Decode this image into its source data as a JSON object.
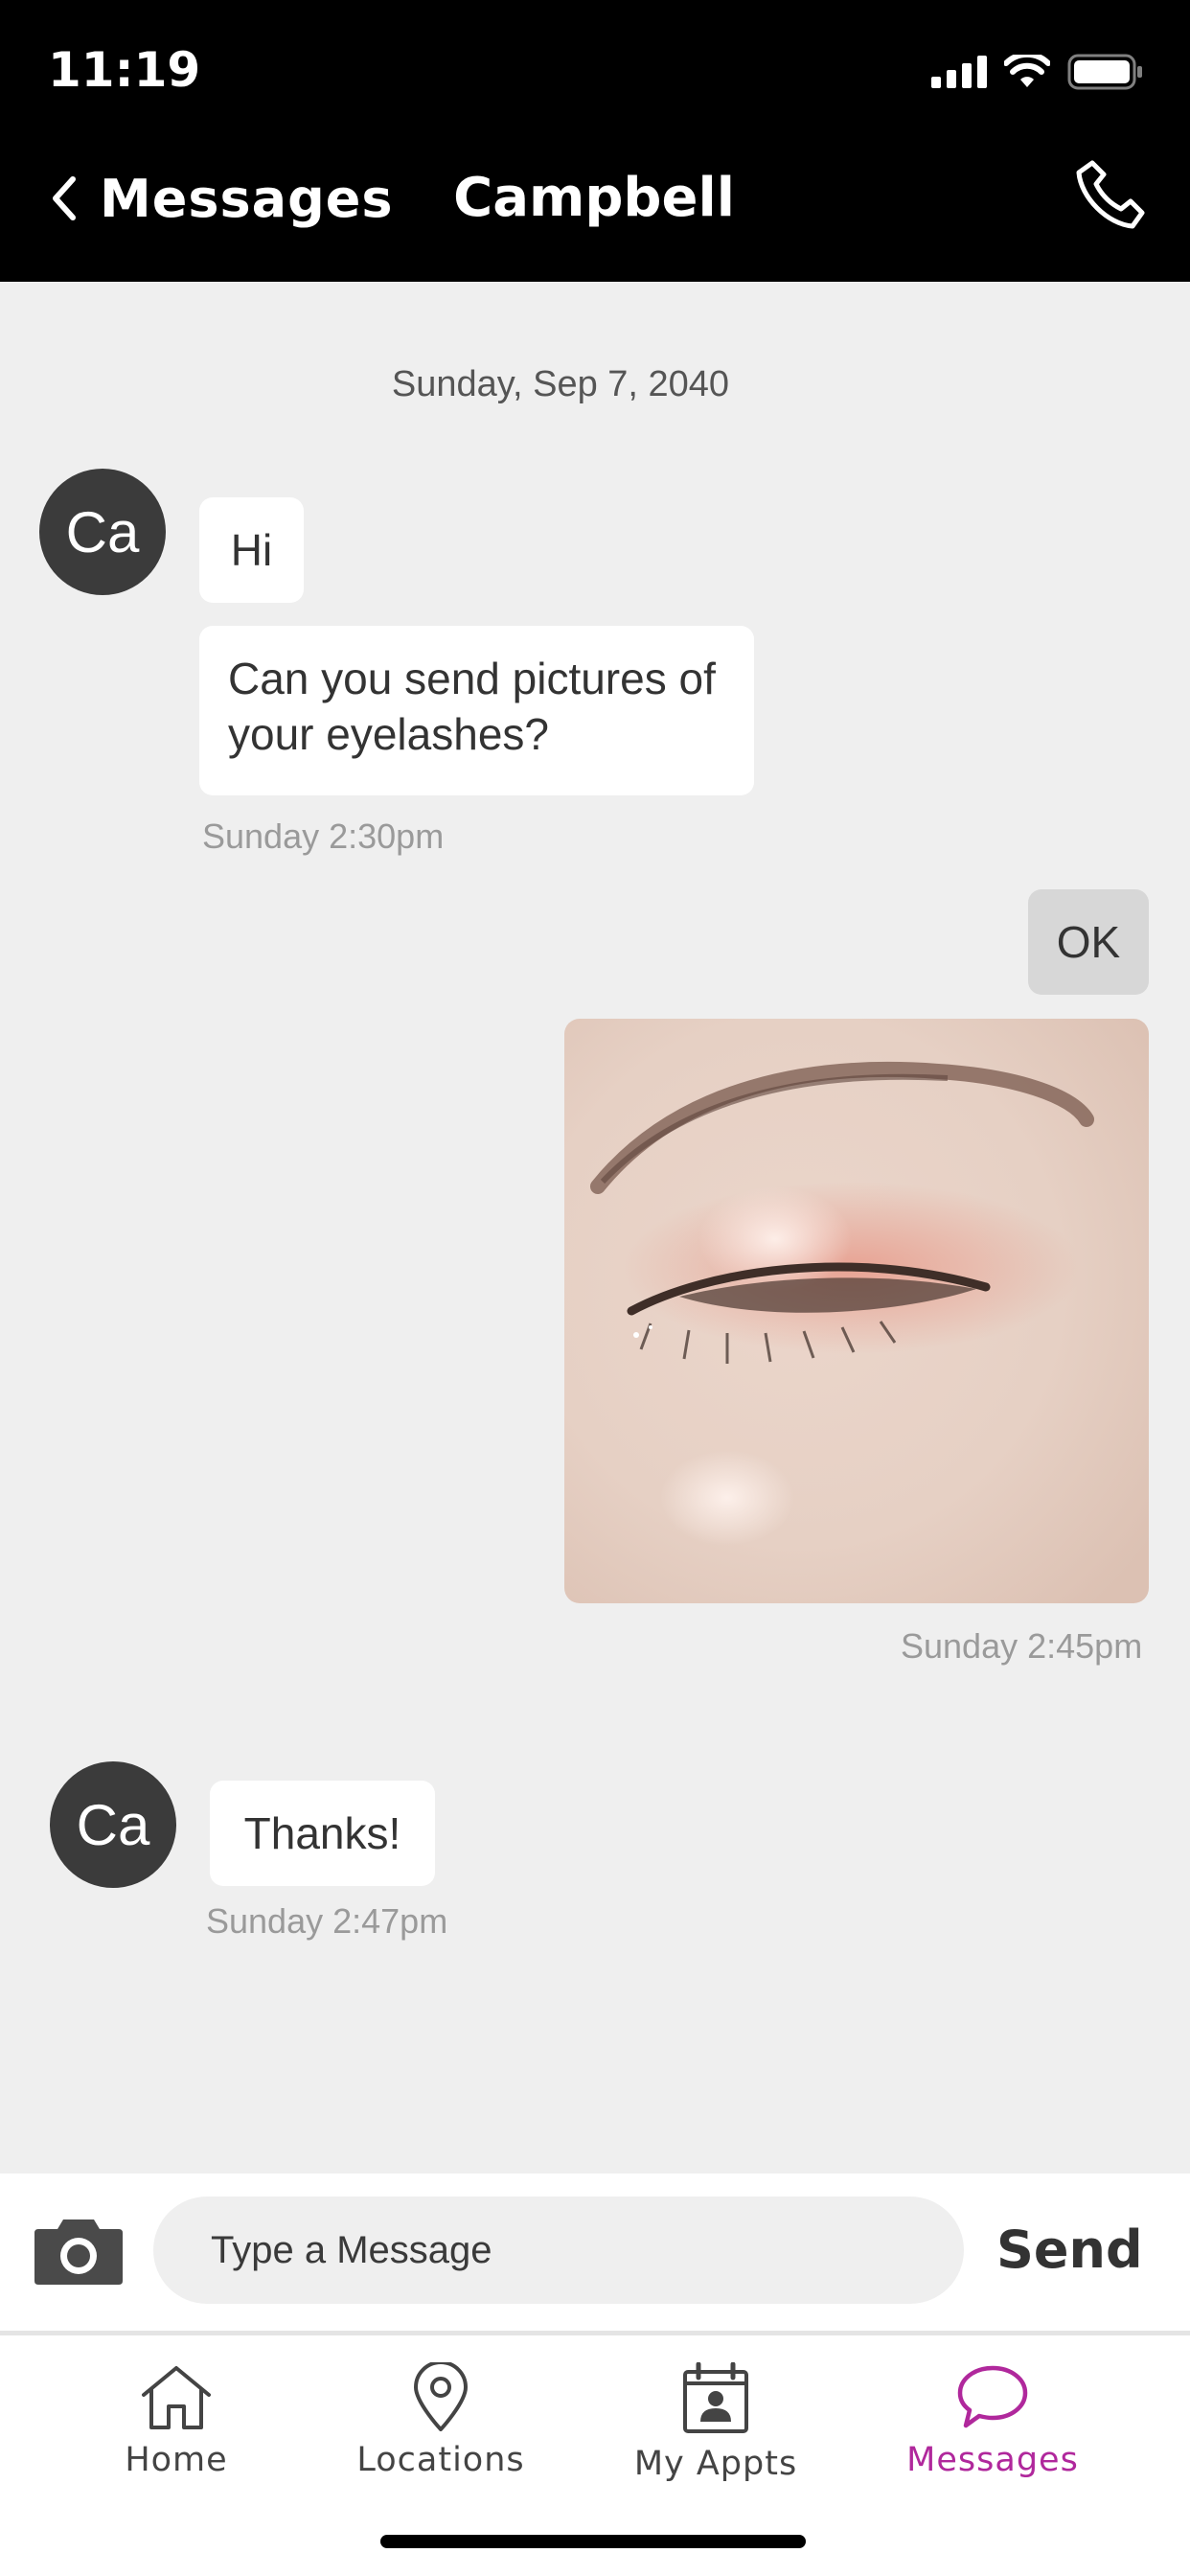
{
  "status_bar": {
    "time": "11:19"
  },
  "nav": {
    "back_label": "Messages",
    "title": "Campbell"
  },
  "chat": {
    "date_separator": "Sunday, Sep 7, 2040",
    "avatar_initials": "Ca",
    "messages": [
      {
        "text": "Hi"
      },
      {
        "text": "Can you send pictures of your eyelashes?"
      },
      {
        "time": "Sunday 2:30pm"
      },
      {
        "text": "OK"
      },
      {
        "time": "Sunday 2:45pm"
      },
      {
        "text": "Thanks!"
      },
      {
        "time": "Sunday 2:47pm"
      }
    ]
  },
  "composer": {
    "placeholder": "Type a Message",
    "send_label": "Send"
  },
  "tabbar": {
    "tabs": [
      {
        "label": "Home",
        "icon": "home-icon"
      },
      {
        "label": "Locations",
        "icon": "location-pin-icon"
      },
      {
        "label": "My Appts",
        "icon": "calendar-person-icon"
      },
      {
        "label": "Messages",
        "icon": "chat-bubble-icon"
      }
    ],
    "active_color": "#b0289c"
  },
  "colors": {
    "header_bg": "#000000",
    "chat_bg": "#efefef",
    "incoming_bubble": "#ffffff",
    "outgoing_bubble": "#d7d7d7"
  }
}
